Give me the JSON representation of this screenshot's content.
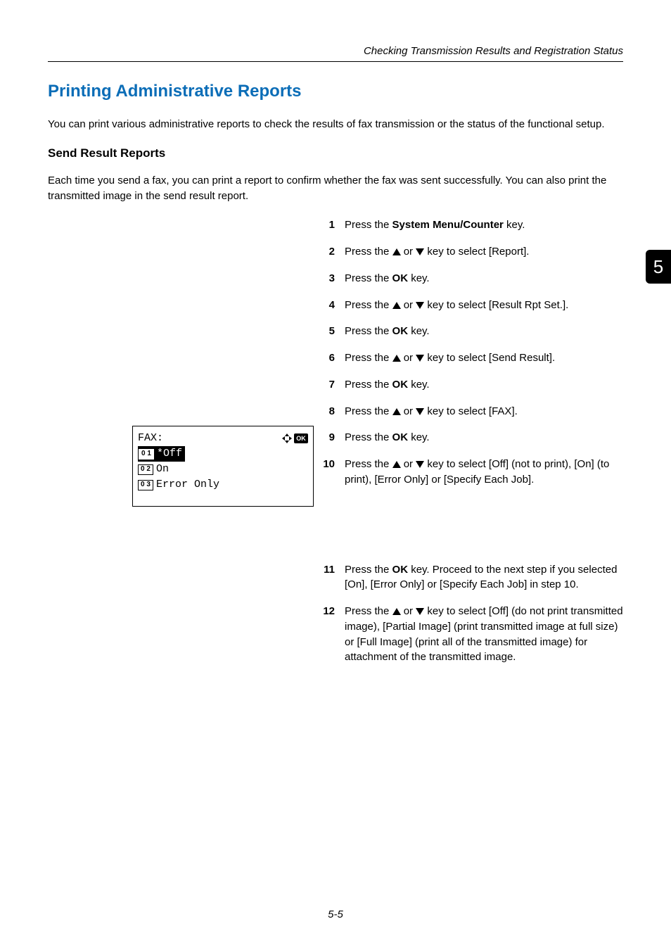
{
  "header": {
    "title": "Checking Transmission Results and Registration Status"
  },
  "side": {
    "chapter": "5"
  },
  "h1": "Printing Administrative Reports",
  "intro": "You can print various administrative reports to check the results of fax transmission or the status of the functional setup.",
  "h2": "Send Result Reports",
  "sub_intro": "Each time you send a fax, you can print a report to confirm whether the fax was sent successfully. You can also print the transmitted image in the send result report.",
  "steps": {
    "s1a": "Press the ",
    "s1b": "System Menu/Counter",
    "s1c": " key.",
    "s2a": "Press the ",
    "s2b": " or ",
    "s2c": " key to select [Report].",
    "s3a": "Press the ",
    "s3b": "OK",
    "s3c": " key.",
    "s4a": "Press the ",
    "s4b": " or ",
    "s4c": " key to select [Result Rpt Set.].",
    "s5a": "Press the ",
    "s5b": "OK",
    "s5c": " key.",
    "s6a": "Press the ",
    "s6b": " or ",
    "s6c": " key to select [Send Result].",
    "s7a": "Press the ",
    "s7b": "OK",
    "s7c": " key.",
    "s8a": "Press the ",
    "s8b": " or ",
    "s8c": " key to select [FAX].",
    "s9a": "Press the ",
    "s9b": "OK",
    "s9c": " key.",
    "s10a": "Press the ",
    "s10b": " or ",
    "s10c": " key to select [Off] (not to print), [On] (to print), [Error Only] or [Specify Each Job].",
    "s11a": "Press the ",
    "s11b": "OK",
    "s11c": " key. Proceed to the next step if you selected [On], [Error Only] or [Specify Each Job] in step 10.",
    "s12a": "Press the ",
    "s12b": " or ",
    "s12c": " key to select [Off] (do not print transmitted image), [Partial Image] (print transmitted image at full size) or [Full Image] (print all of the transmitted image) for attachment of the transmitted image."
  },
  "nums": {
    "n1": "1",
    "n2": "2",
    "n3": "3",
    "n4": "4",
    "n5": "5",
    "n6": "6",
    "n7": "7",
    "n8": "8",
    "n9": "9",
    "n10": "10",
    "n11": "11",
    "n12": "12"
  },
  "lcd": {
    "title": "FAX:",
    "ok": "OK",
    "row1_num": "0 1",
    "row1_txt": "*Off",
    "row2_num": "0 2",
    "row2_txt": "On",
    "row3_num": "0 3",
    "row3_txt": "Error Only"
  },
  "footer": {
    "page": "5-5"
  }
}
